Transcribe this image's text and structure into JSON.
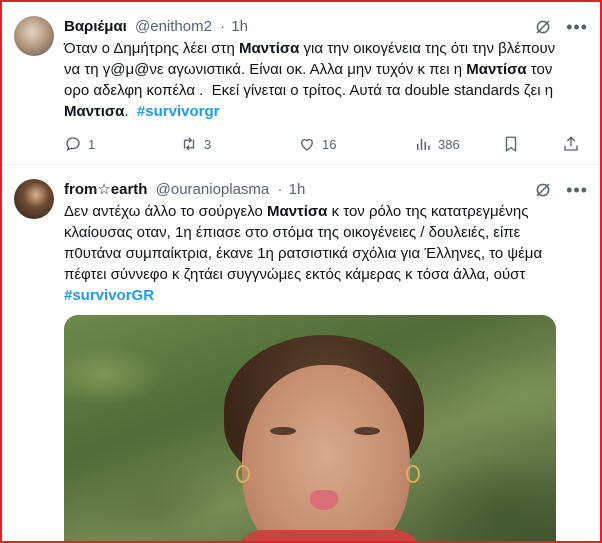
{
  "tweets": [
    {
      "display_name": "Βαριέμαι",
      "handle": "@enithom2",
      "time": "1h",
      "text_lines": [
        [
          "Όταν ο Δημήτρης λέει στη ",
          {
            "b": "Μαντίσα"
          },
          " για την οικογένεια της ότι την βλέπουν"
        ],
        [
          "να τη γ@μ@νε αγωνιστικά. Είναι οκ. Αλλα μην τυχόν κ πει η ",
          {
            "b": "Μαντίσα"
          },
          " τον"
        ],
        [
          "ορο αδελφη κοπέλα .  Εκεί γίνεται ο τρίτος. Αυτά τα double standards ζει η"
        ],
        [
          {
            "b": "Μαντισα"
          },
          ".  ",
          {
            "tag": "#survivorgr"
          }
        ]
      ],
      "stats": {
        "replies": "1",
        "reposts": "3",
        "likes": "16",
        "views": "386"
      }
    },
    {
      "display_name": "from☆earth",
      "handle": "@ouranioplasma",
      "time": "1h",
      "text_lines": [
        [
          "Δεν αντέχω άλλο το σούργελο ",
          {
            "b": "Μαντίσα"
          },
          " κ τον ρόλο της κατατρεγμένης"
        ],
        [
          "κλαίουσας οταν, 1η έπιασε στο στόμα της οικογένειες / δουλειές, είπε"
        ],
        [
          "π0υτάνα συμπαίκτρια, έκανε 1η ρατσιστικά σχόλια για Έλληνες, το ψέμα"
        ],
        [
          "πέφτει σύννεφο κ ζητάει συγγνώμες εκτός κάμερας κ τόσα άλλα, ούστ"
        ],
        [
          {
            "tag": "#survivorGR"
          }
        ]
      ]
    }
  ],
  "icons": {
    "grok": "grok-icon",
    "more": "more-icon",
    "reply": "reply-icon",
    "repost": "repost-icon",
    "like": "like-icon",
    "views": "views-icon",
    "bookmark": "bookmark-icon",
    "share": "share-icon"
  },
  "colors": {
    "hashtag": "#1d9bf0",
    "secondary_text": "#536471",
    "frame_border": "#e0232b"
  }
}
